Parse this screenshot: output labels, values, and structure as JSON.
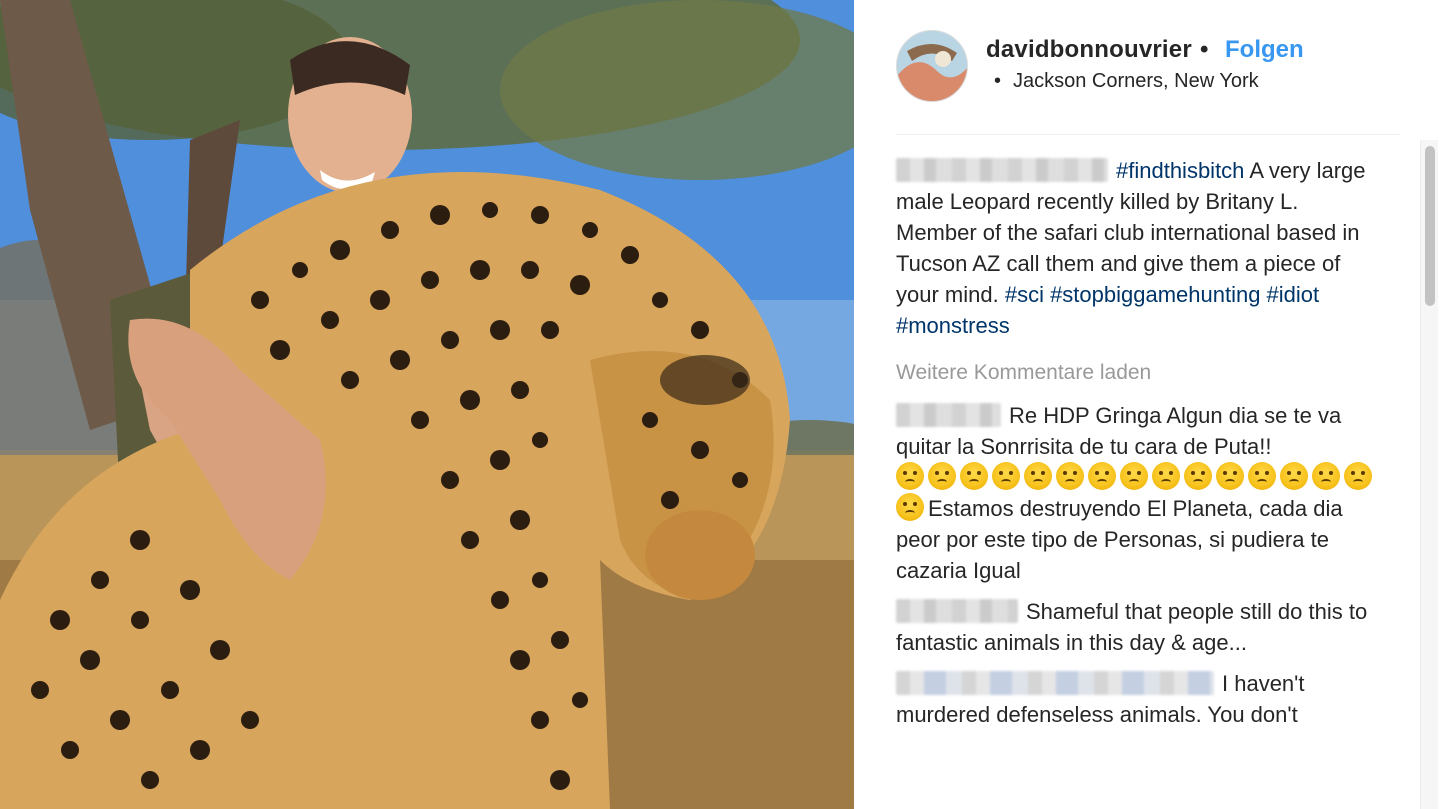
{
  "post": {
    "username": "davidbonnouvrier",
    "separator": "•",
    "follow_label": "Folgen",
    "location_dot": "•",
    "location": "Jackson Corners, New York"
  },
  "comments": [
    {
      "hashtag": "#findthisbitch",
      "text": " A very large male Leopard recently killed by Britany L. Member of the safari club international based in Tucson AZ call them and give them a piece of your mind. ",
      "tags": "#sci #stopbiggamehunting #idiot #monstress"
    },
    {
      "text_before": "Re HDP Gringa Algun dia se te va quitar la Sonrrisita de tu cara de Puta!!",
      "emoji_name": "angry-face-icon",
      "emoji_count": 16,
      "text_after": "Estamos destruyendo El Planeta, cada dia peor por este tipo de Personas, si pudiera te cazaria Igual"
    },
    {
      "text": "Shameful that people still do this to fantastic animals in this day & age..."
    },
    {
      "text": "I haven't murdered defenseless animals. You don't"
    }
  ],
  "load_more_label": "Weitere Kommentare laden",
  "colors": {
    "link_blue": "#3897f0",
    "hashtag_blue": "#003569",
    "muted_gray": "#999999",
    "text": "#262626"
  }
}
